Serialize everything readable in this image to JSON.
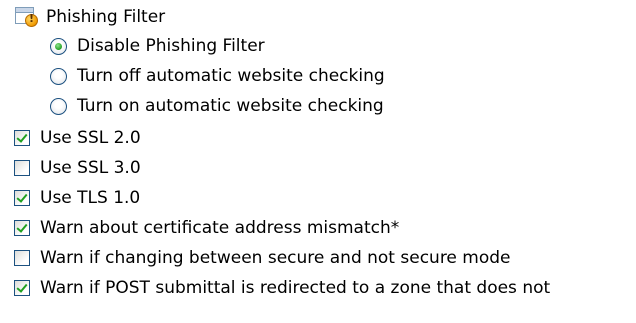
{
  "phishing": {
    "title": "Phishing Filter",
    "options": [
      {
        "label": "Disable Phishing Filter",
        "selected": true
      },
      {
        "label": "Turn off automatic website checking",
        "selected": false
      },
      {
        "label": "Turn on automatic website checking",
        "selected": false
      }
    ]
  },
  "security_options": [
    {
      "label": "Use SSL 2.0",
      "checked": true
    },
    {
      "label": "Use SSL 3.0",
      "checked": false
    },
    {
      "label": "Use TLS 1.0",
      "checked": true
    },
    {
      "label": "Warn about certificate address mismatch*",
      "checked": true
    },
    {
      "label": "Warn if changing between secure and not secure mode",
      "checked": false
    },
    {
      "label": "Warn if POST submittal is redirected to a zone that does not",
      "checked": true
    }
  ],
  "icons": {
    "section": "phishing-filter-icon"
  },
  "colors": {
    "check_green": "#21a121",
    "control_border": "#1c5180"
  }
}
